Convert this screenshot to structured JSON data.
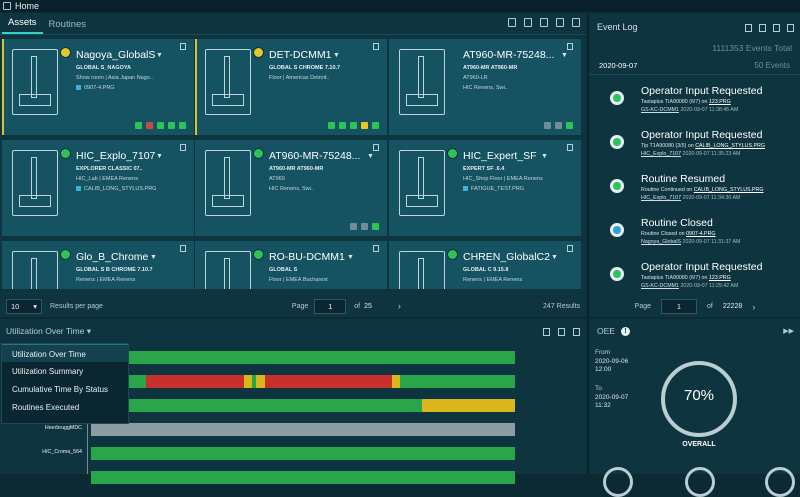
{
  "app": {
    "title": "Home"
  },
  "assets": {
    "tabs": [
      {
        "label": "Assets"
      },
      {
        "label": "Routines"
      }
    ],
    "cards": [
      {
        "name": "Nagoya_GlobalS",
        "line1": "GLOBAL S_NAGOYA",
        "line2": "Show room | Asia Japan Nago..",
        "line3": "0907-4.PRG",
        "status": "yellow",
        "warn": true
      },
      {
        "name": "DET-DCMM1",
        "line1": "GLOBAL S CHROME 7.10.7",
        "line2": "Floor | Americas Detroit..",
        "line3": "",
        "status": "yellow",
        "warn": true
      },
      {
        "name": "AT960-MR-75248...",
        "line1": "AT960-MR  AT960-MR",
        "line2": "AT960-LR",
        "line3": "HIC Renens, Swi..",
        "status": "none",
        "warn": false
      },
      {
        "name": "HIC_Explo_7107",
        "line1": "EXPLORER CLASSIC 07..",
        "line2": "HIC_Lab | EMEA Renens",
        "line3": "CALIB_LONG_STYLUS.PRG",
        "status": "green",
        "warn": false
      },
      {
        "name": "AT960-MR-75248...",
        "line1": "AT960-MR  AT960-MR",
        "line2": "AT960",
        "line3": "HIC Renens, Swi..",
        "status": "green",
        "warn": false
      },
      {
        "name": "HIC_Expert_SF",
        "line1": "EXPERT SF .6.4",
        "line2": "HIC_Shop Floor | EMEA Renens",
        "line3": "FATIGUE_TEST.PRG",
        "status": "green",
        "warn": false
      },
      {
        "name": "Glo_B_Chrome",
        "line1": "GLOBAL S B CHROME 7.10.7",
        "line2": "Renens | EMEA Renens",
        "line3": "",
        "status": "green",
        "warn": false
      },
      {
        "name": "RO-BU-DCMM1",
        "line1": "GLOBAL S",
        "line2": "Floor | EMEA Bucharest",
        "line3": "",
        "status": "green",
        "warn": false
      },
      {
        "name": "CHREN_GlobalC2",
        "line1": "GLOBAL C 9.15.8",
        "line2": "Renens | EMEA Renens",
        "line3": "",
        "status": "green",
        "warn": false
      }
    ],
    "pager": {
      "per_page": "10",
      "per_page_label": "Results per page",
      "page_label": "Page",
      "page": "1",
      "of_label": "of",
      "total_pages": "25",
      "results": "247 Results"
    }
  },
  "event_log": {
    "title": "Event Log",
    "total": "1111353 Events Total",
    "date": "2020-09-07",
    "shown": "50 Events",
    "events": [
      {
        "title": "Operator Input Requested",
        "l1": "Tastaplus TIA90080 (6/7) on",
        "l1_link": "123.PRG",
        "l2_ts": "2020-09-07 11:38:45 AM",
        "l2_link": "GS-KC-DCMM1",
        "icon": "green"
      },
      {
        "title": "Operator Input Requested",
        "l1": "Tip T1A90080 (3/5) on",
        "l1_link": "CALIB_LONG_STYLUS.PRG",
        "l2_ts": "2020-09-07 11:35:23 AM",
        "l2_link": "HIC_Explo_7107",
        "icon": "green"
      },
      {
        "title": "Routine Resumed",
        "l1": "Routine Continued on",
        "l1_link": "CALIB_LONG_STYLUS.PRG",
        "l2_ts": "2020-09-07 11:34:30 AM",
        "l2_link": "HIC_Explo_7107",
        "icon": "green"
      },
      {
        "title": "Routine Closed",
        "l1": "Routine Closed on",
        "l1_link": "0907-4.PRG",
        "l2_ts": "2020-09-07 11:31:37 AM",
        "l2_link": "Nagoya_GlobalS",
        "icon": "blue"
      },
      {
        "title": "Operator Input Requested",
        "l1": "Tastaplus TIA90080 (6/7) on",
        "l1_link": "123.PRG",
        "l2_ts": "2020-09-07 11:29:42 AM",
        "l2_link": "GS-KC-DCMM1",
        "icon": "green"
      }
    ],
    "pager": {
      "page_label": "Page",
      "page": "1",
      "of_label": "of",
      "total_pages": "22228"
    }
  },
  "utilization": {
    "title": "Utilization Over Time",
    "menu": [
      "Utilization Over Time",
      "Utilization Summary",
      "Cumulative Time By Status",
      "Routines Executed"
    ],
    "row_labels": [
      "HeerbruggMDC",
      "HIC_Croma_564"
    ],
    "colors": {
      "green": "#29a64a",
      "yellow": "#d8b61c",
      "red": "#c7302b",
      "grey": "#8c9ea3"
    }
  },
  "oee": {
    "title": "OEE",
    "from_label": "From",
    "from_date": "2020-09-06",
    "from_time": "12:00",
    "to_label": "To",
    "to_date": "2020-09-07",
    "to_time": "11:32",
    "percent": "70%",
    "label": "OVERALL"
  }
}
